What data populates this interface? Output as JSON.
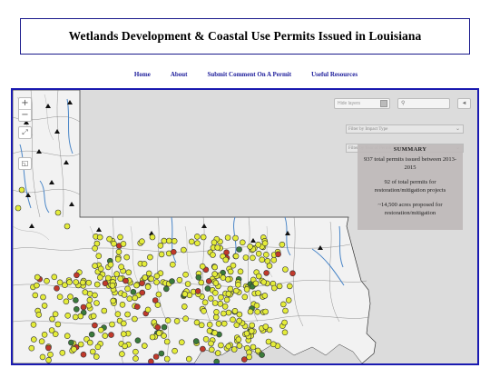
{
  "header": {
    "title": "Wetlands Development & Coastal Use Permits Issued in Louisiana"
  },
  "nav": {
    "items": [
      "Home",
      "About",
      "Submit Comment On A Permit",
      "Useful Resources"
    ]
  },
  "map": {
    "controls": {
      "zoom_in": "+",
      "zoom_out": "−",
      "fullscreen": "⤢",
      "layers": "◱"
    },
    "toolbar": {
      "layer_toggle": "Hide layers",
      "search_icon": "search-icon",
      "locate_icon": "locate-icon"
    },
    "filters": {
      "impact_type": "Filter by Impact Type",
      "year_issued": "Filter by Year of Permit Issue"
    },
    "summary": {
      "title": "SUMMARY",
      "line1": "937 total permits issued between 2013-2015",
      "line2": "92 of total permits for restoration/mitigation projects",
      "line3": "~14,500 acres proposed for restoration/mitigation"
    },
    "colors": {
      "permit": "#e4ec3a",
      "restoration": "#c0392b",
      "other": "#3a7a3a",
      "water": "#4a86c8"
    }
  }
}
